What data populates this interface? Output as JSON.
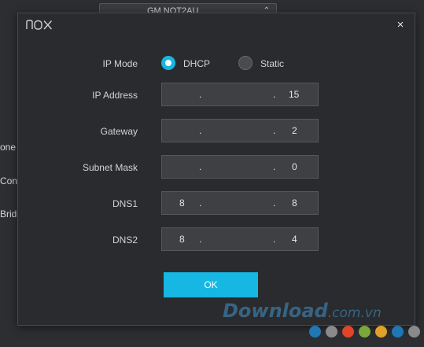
{
  "background": {
    "device_select_text": "GM NOT2AU",
    "side_labels": [
      "one",
      "Conn",
      "Bridg"
    ]
  },
  "dialog": {
    "logo_text": "nox",
    "close_glyph": "×",
    "ip_mode": {
      "label": "IP Mode",
      "options": [
        {
          "label": "DHCP",
          "selected": true
        },
        {
          "label": "Static",
          "selected": false
        }
      ]
    },
    "fields": [
      {
        "label": "IP Address",
        "octets": [
          "",
          "",
          "",
          "15"
        ]
      },
      {
        "label": "Gateway",
        "octets": [
          "",
          "",
          "",
          "2"
        ]
      },
      {
        "label": "Subnet Mask",
        "octets": [
          "",
          "",
          "",
          "0"
        ]
      },
      {
        "label": "DNS1",
        "octets": [
          "8",
          "",
          "",
          "8"
        ]
      },
      {
        "label": "DNS2",
        "octets": [
          "8",
          "",
          "",
          "4"
        ]
      }
    ],
    "ok_label": "OK"
  },
  "watermark": {
    "brand": "Download",
    "suffix": ".com.vn",
    "dot_colors": [
      "#1f78b4",
      "#8a8a8a",
      "#e0452b",
      "#7aa83a",
      "#e0a12a",
      "#1f78b4",
      "#8a8a8a"
    ]
  },
  "colors": {
    "accent": "#16b7e3",
    "dialog_bg": "#2a2b2e",
    "field_bg": "#3f4044"
  }
}
